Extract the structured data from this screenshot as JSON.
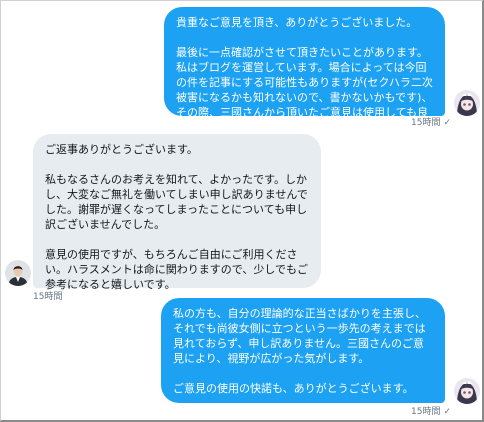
{
  "messages": [
    {
      "side": "sent",
      "text": "貴重なご意見を頂き、ありがとうございました。\n\n最後に一点確認がさせて頂きたいことがあります。\n私はブログを運営しています。場合によっては今回の件を記事にする可能性もありますが(セクハラ二次被害になるかも知れないので、書かないかもです)、その際、三國さんから頂いたご意見は使用しても良いでしょうか？",
      "timestamp": "15時間",
      "check": "✓"
    },
    {
      "side": "received",
      "text": "ご返事ありがとうございます。\n\n私もなるさんのお考えを知れて、よかったです。しかし、大変なご無礼を働いてしまい申し訳ありませんでした。謝罪が遅くなってしまったことについても申し訳ございませんでした。\n\n意見の使用ですが、もちろんご自由にご利用ください。ハラスメントは命に関わりますので、少しでもご参考になると嬉しいです。",
      "timestamp": "15時間"
    },
    {
      "side": "sent",
      "text": "私の方も、自分の理論的な正当さばかりを主張し、それでも尚彼女側に立つという一歩先の考えまでは見れておらず、申し訳ありません。三國さんのご意見により、視野が広がった気がします。\n\nご意見の使用の快諾も、ありがとうございます。",
      "timestamp": "15時間",
      "check": "✓"
    }
  ]
}
